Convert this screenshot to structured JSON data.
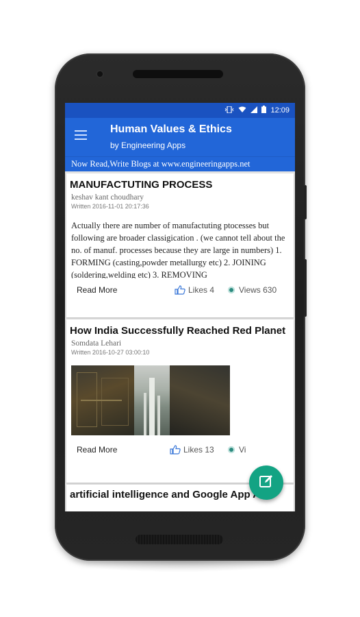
{
  "status_bar": {
    "time": "12:09",
    "icons": [
      "vibrate-icon",
      "wifi-icon",
      "signal-icon",
      "battery-icon"
    ]
  },
  "app_bar": {
    "title": "Human Values & Ethics",
    "subtitle": "by Engineering Apps",
    "menu_icon": "hamburger-menu-icon"
  },
  "banner": {
    "text": "Now Read,Write Blogs at www.engineeringapps.net"
  },
  "posts": [
    {
      "title": "MANUFACTUTING PROCESS",
      "author": "keshav kant choudhary",
      "date": "Written 2016-11-01 20:17:36",
      "excerpt": "Actually there are number of manufactuting ptocesses but following are broader classigication . (we cannot tell about the no. of manuf. processes because they are large in numbers) 1. FORMING (casting,powder metallurgy etc) 2. JOINING (soldering,welding etc) 3. REMOVING",
      "read_more": "Read More",
      "likes": "Likes 4",
      "views": "Views 630"
    },
    {
      "title": "How India Successfully Reached Red Planet",
      "author": "Somdata Lehari",
      "date": "Written 2016-10-27 03:00:10",
      "read_more": "Read More",
      "likes": "Likes 13",
      "views": "Vi"
    },
    {
      "title": "artificial intelligence and Google App Allo"
    }
  ],
  "fab": {
    "icon": "edit-icon"
  },
  "colors": {
    "status_bar": "#1a52c0",
    "app_bar": "#2266d8",
    "fab": "#13a383",
    "views_icon": "#2b8a7e",
    "likes_icon": "#3b78d8"
  }
}
